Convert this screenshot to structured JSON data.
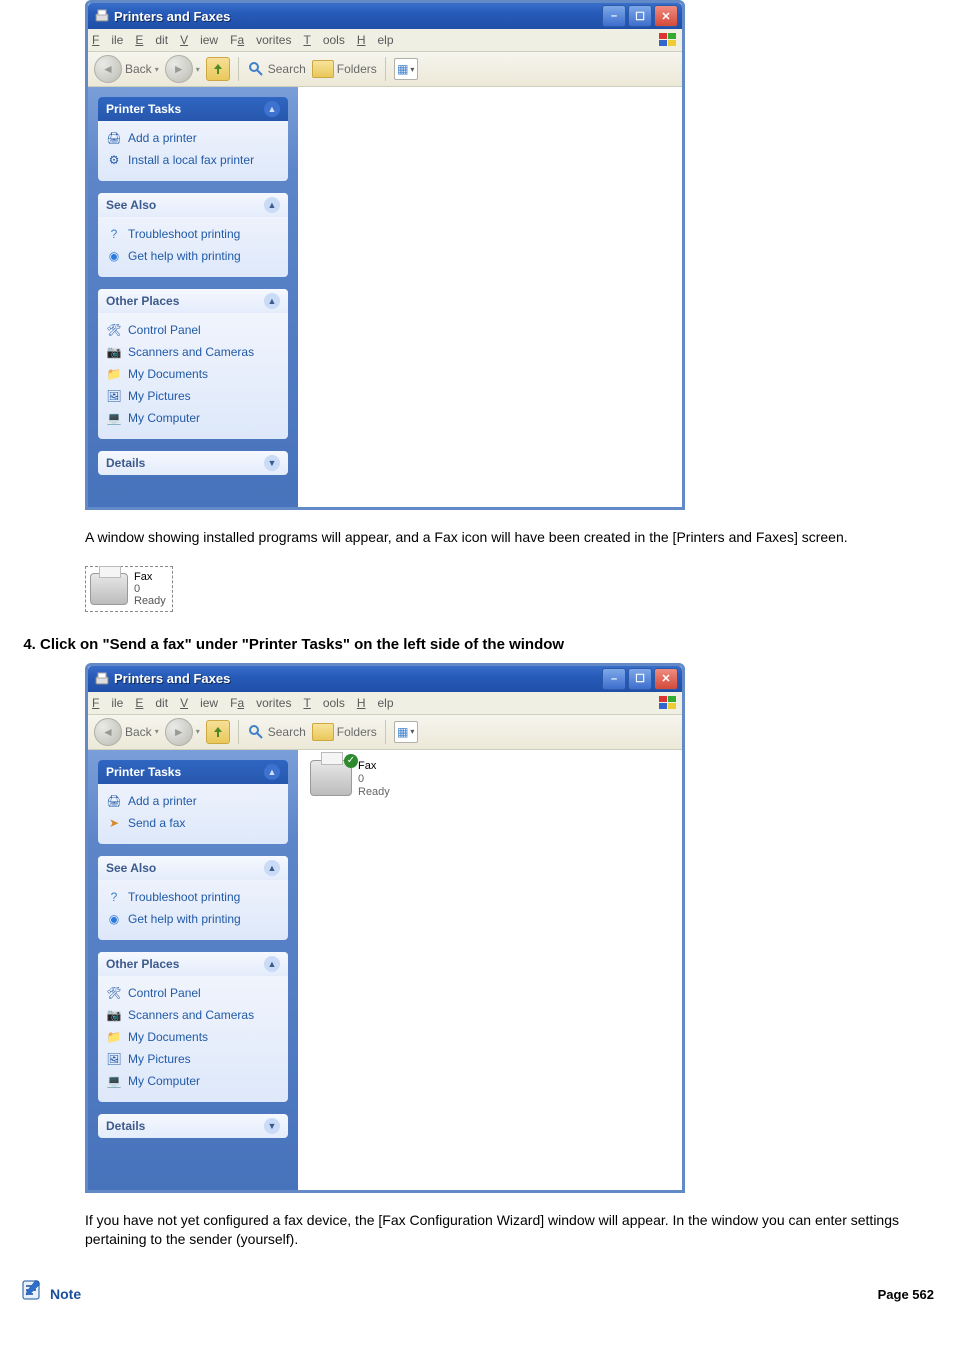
{
  "windowTitle": "Printers and Faxes",
  "menu": {
    "file": "File",
    "edit": "Edit",
    "view": "View",
    "favorites": "Favorites",
    "tools": "Tools",
    "help": "Help"
  },
  "toolbar": {
    "back": "Back",
    "search": "Search",
    "folders": "Folders"
  },
  "panels": {
    "printerTasks": "Printer Tasks",
    "seeAlso": "See Also",
    "otherPlaces": "Other Places",
    "details": "Details"
  },
  "tasks1": {
    "addPrinter": "Add a printer",
    "installLocalFax": "Install a local fax printer"
  },
  "tasks2": {
    "addPrinter": "Add a printer",
    "sendFax": "Send a fax"
  },
  "seeAlsoItems": {
    "troubleshoot": "Troubleshoot printing",
    "getHelp": "Get help with printing"
  },
  "otherPlacesItems": {
    "controlPanel": "Control Panel",
    "scanners": "Scanners and Cameras",
    "myDocs": "My Documents",
    "myPics": "My Pictures",
    "myComputer": "My Computer"
  },
  "text1": "A window showing installed programs will appear, and a Fax icon will have been created in the [Printers and Faxes] screen.",
  "faxIcon": {
    "name": "Fax",
    "docs": "0",
    "status": "Ready"
  },
  "step4": "Click on \"Send a fax\" under \"Printer Tasks\" on the left side of the window",
  "faxItem": {
    "name": "Fax",
    "docs": "0",
    "status": "Ready"
  },
  "text2": "If you have not yet configured a fax device, the [Fax Configuration Wizard] window will appear. In the window you can enter settings pertaining to the sender (yourself).",
  "note": "Note",
  "pageNumber": "Page 562"
}
